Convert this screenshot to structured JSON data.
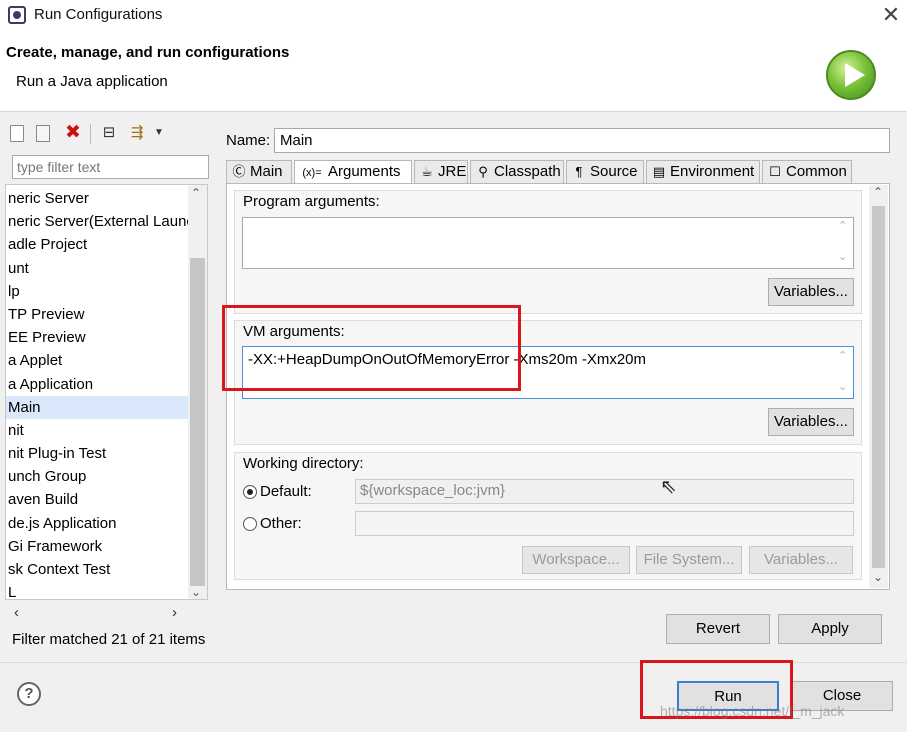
{
  "window": {
    "title": "Run Configurations",
    "close_glyph": "✕"
  },
  "header": {
    "title": "Create, manage, and run configurations",
    "subtitle": "Run a Java application"
  },
  "left": {
    "filter_placeholder": "type filter text",
    "tree_items": [
      "neric Server",
      "neric Server(External Launc",
      "adle Project",
      "unt",
      "lp",
      "TP Preview",
      "EE Preview",
      "a Applet",
      "a Application",
      "Main",
      "nit",
      "nit Plug-in Test",
      "unch Group",
      "aven Build",
      "de.js Application",
      "Gi Framework",
      "sk Context Test",
      "L"
    ],
    "selected_index": 9,
    "status": "Filter matched 21 of 21 items"
  },
  "config": {
    "name_label": "Name:",
    "name_value": "Main",
    "tabs": [
      {
        "label": "Main",
        "icon": "main-class-icon",
        "glyph": "Ⓒ"
      },
      {
        "label": "Arguments",
        "icon": "arguments-icon",
        "glyph": "(x)="
      },
      {
        "label": "JRE",
        "icon": "jre-icon",
        "glyph": "☕"
      },
      {
        "label": "Classpath",
        "icon": "classpath-icon",
        "glyph": "⚲"
      },
      {
        "label": "Source",
        "icon": "source-icon",
        "glyph": "¶"
      },
      {
        "label": "Environment",
        "icon": "environment-icon",
        "glyph": "▤"
      },
      {
        "label": "Common",
        "icon": "common-icon",
        "glyph": "☐"
      }
    ],
    "active_tab": "Arguments",
    "program_args_label": "Program arguments:",
    "program_args_value": "",
    "vm_args_label": "VM arguments:",
    "vm_args_value": "-XX:+HeapDumpOnOutOfMemoryError -Xms20m -Xmx20m",
    "variables_label": "Variables...",
    "working_dir": {
      "label": "Working directory:",
      "default_label": "Default:",
      "default_value": "${workspace_loc:jvm}",
      "other_label": "Other:",
      "selected": "Default",
      "workspace_btn": "Workspace...",
      "filesystem_btn": "File System...",
      "variables_btn": "Variables..."
    },
    "revert_label": "Revert",
    "apply_label": "Apply"
  },
  "footer": {
    "help_glyph": "?",
    "run_label": "Run",
    "close_label": "Close"
  },
  "watermark": "https://blog.csdn.net/l_m_jack",
  "colors": {
    "highlight": "#d9161c",
    "run_icon": "#5fb52b",
    "selection": "#d9e8fb"
  }
}
